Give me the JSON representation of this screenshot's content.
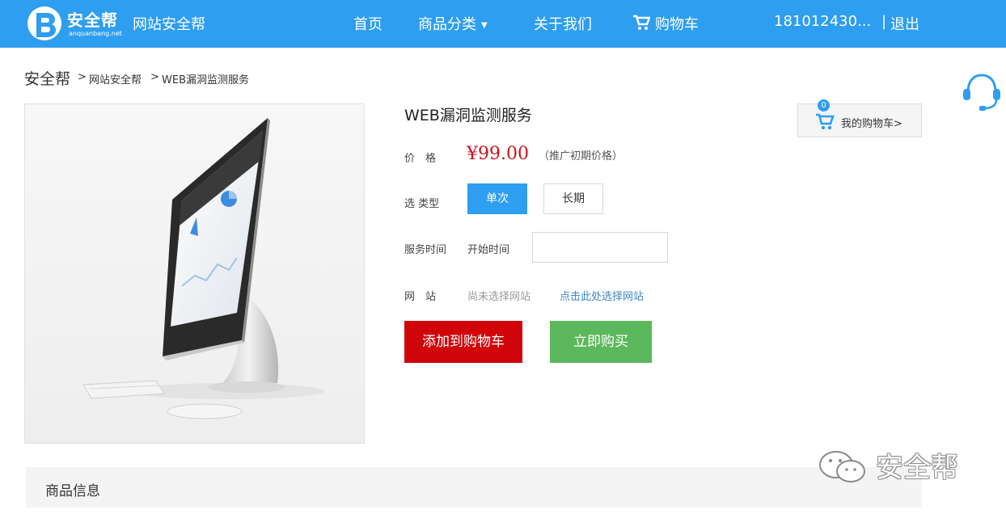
{
  "header": {
    "logo_text": "安全帮",
    "logo_domain": "anquanbang.net",
    "site_name": "网站安全帮",
    "nav": {
      "home": "首页",
      "categories": "商品分类",
      "about": "关于我们",
      "cart": "购物车"
    },
    "user": "181012430...",
    "separator": "|",
    "logout": "退出",
    "bg_color": "#2e9ef0"
  },
  "breadcrumb": {
    "home": "安全帮",
    "sep": ">",
    "level1": "网站安全帮",
    "level2": "WEB漏洞监测服务"
  },
  "product": {
    "title": "WEB漏洞监测服务",
    "price_label": "价　格",
    "price": "¥99.00",
    "price_note": "（推广初期价格）",
    "type_label": "选 类型",
    "type_options": [
      "单次",
      "长期"
    ],
    "selected_type": "单次",
    "service_time_label": "服务时间",
    "start_time_label": "开始时间",
    "start_time_value": "",
    "website_label": "网　站",
    "website_value": "尚未选择网站",
    "website_pick": "点击此处选择网站",
    "add_to_cart": "添加到购物车",
    "buy_now": "立即购买",
    "price_color": "#c8161d",
    "add_color": "#d0060b",
    "buy_color": "#5cb85c"
  },
  "mini_cart": {
    "count": "0",
    "label": "我的购物车>"
  },
  "tabs": {
    "info": "商品信息"
  },
  "watermark": {
    "text": "安全帮"
  },
  "icons": {
    "logo": "b-logo-icon",
    "cart": "cart-icon",
    "caret": "caret-down-icon",
    "support": "headset-icon",
    "wechat": "wechat-icon"
  }
}
